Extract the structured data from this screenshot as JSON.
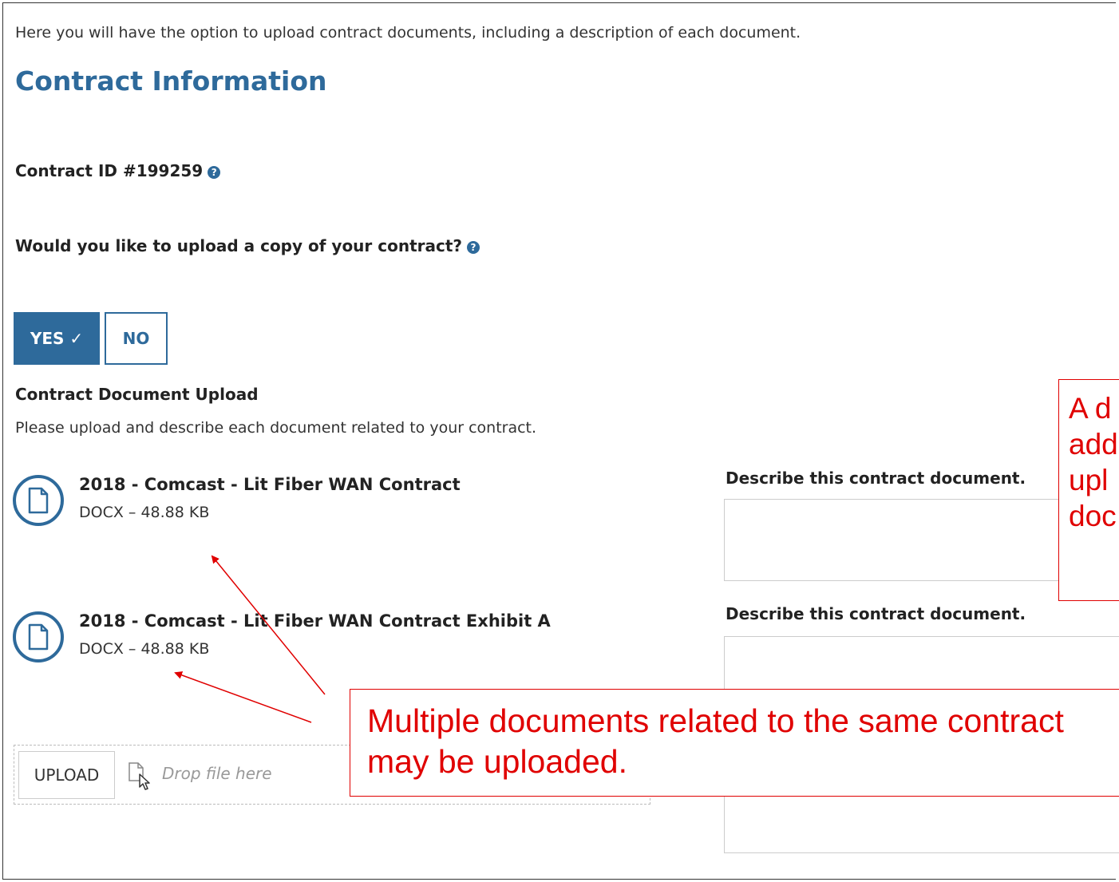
{
  "intro": "Here you will have the option to upload contract documents, including a description of each document.",
  "page_title": "Contract Information",
  "contract_id_label": "Contract ID #199259",
  "upload_question": "Would you like to upload a copy of your contract?",
  "yes_label": "YES ✓",
  "no_label": "NO",
  "section_title": "Contract Document Upload",
  "section_subtitle": "Please upload and describe each document related to your contract.",
  "documents": [
    {
      "name": "2018 - Comcast - Lit Fiber WAN Contract",
      "meta": "DOCX – 48.88 KB",
      "description_label": "Describe this contract document."
    },
    {
      "name": "2018 - Comcast - Lit Fiber WAN Contract Exhibit A",
      "meta": "DOCX – 48.88 KB",
      "description_label": "Describe this contract document."
    }
  ],
  "upload_button": "UPLOAD",
  "drop_text": "Drop file here",
  "callout_right": [
    "A d",
    "add",
    "upl",
    "doc"
  ],
  "callout_main": [
    "Multiple documents related to the same contract",
    "may be uploaded."
  ],
  "colors": {
    "accent": "#2e6a9b",
    "annotation": "#e00000"
  }
}
